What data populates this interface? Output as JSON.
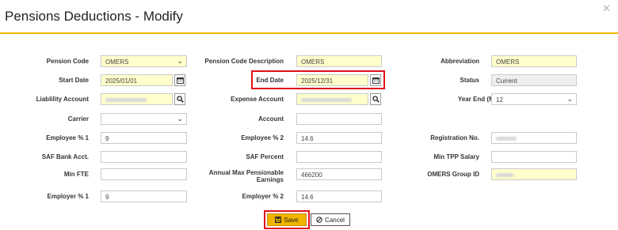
{
  "title": "Pensions Deductions - Modify",
  "close_icon": "✕",
  "colors": {
    "accent": "#f2b400",
    "required_bg": "#ffffcc",
    "highlight": "#e0101a"
  },
  "fields": {
    "pension_code": {
      "label": "Pension Code",
      "value": "OMERS"
    },
    "pension_code_description": {
      "label": "Pension Code Description",
      "value": "OMERS"
    },
    "abbreviation": {
      "label": "Abbreviation",
      "value": "OMERS"
    },
    "start_date": {
      "label": "Start Date",
      "value": "2025/01/01"
    },
    "end_date": {
      "label": "End Date",
      "value": "2025/12/31"
    },
    "status": {
      "label": "Status",
      "value": "Current"
    },
    "liability_account": {
      "label": "Liablility Account",
      "value": ""
    },
    "expense_account": {
      "label": "Expense Account",
      "value": ""
    },
    "year_end": {
      "label": "Year End (MM)",
      "value": "12"
    },
    "carrier": {
      "label": "Carrier",
      "value": ""
    },
    "account": {
      "label": "Account",
      "value": ""
    },
    "employee_pct_1": {
      "label": "Employee % 1",
      "value": "9"
    },
    "employee_pct_2": {
      "label": "Employee % 2",
      "value": "14.6"
    },
    "registration_no": {
      "label": "Registration No.",
      "value": ""
    },
    "saf_bank_acct": {
      "label": "SAF Bank Acct.",
      "value": ""
    },
    "saf_percent": {
      "label": "SAF Percent",
      "value": ""
    },
    "min_tpp_salary": {
      "label": "Min TPP Salary",
      "value": ""
    },
    "min_fte": {
      "label": "Min FTE",
      "value": ""
    },
    "annual_max_pensionable_earnings": {
      "label_line1": "Annual Max Pensionable",
      "label_line2": "Earnings",
      "value": "466200"
    },
    "omers_group_id": {
      "label": "OMERS Group ID",
      "value": ""
    },
    "employer_pct_1": {
      "label": "Employer % 1",
      "value": "9"
    },
    "employer_pct_2": {
      "label": "Employer % 2",
      "value": "14.6"
    }
  },
  "buttons": {
    "save": "Save",
    "cancel": "Cancel"
  }
}
